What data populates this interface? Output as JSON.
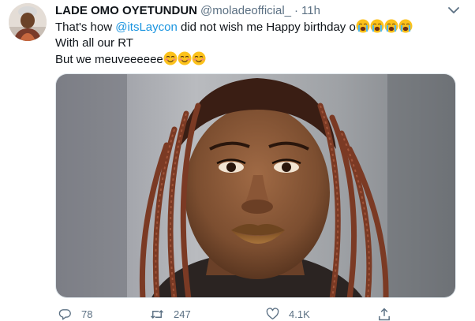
{
  "tweet": {
    "display_name": "LADE OMO OYETUNDUN",
    "handle": "@moladeofficial_",
    "separator": "·",
    "time": "11h",
    "text": {
      "line1_prefix": "That's how ",
      "line1_mention": "@itsLaycon",
      "line1_suffix": " did not wish me Happy birthday o",
      "line2": "With all our RT",
      "line3": "But we meuveeeeee"
    },
    "emojis": {
      "line1": [
        "loudly-crying-face",
        "loudly-crying-face",
        "loudly-crying-face",
        "loudly-crying-face"
      ],
      "line3": [
        "smiling-face-with-smiling-eyes",
        "smiling-face-with-smiling-eyes",
        "smiling-face-with-smiling-eyes"
      ]
    },
    "actions": {
      "reply_count": "78",
      "retweet_count": "247",
      "like_count": "4.1K"
    },
    "colors": {
      "text": "#0f1419",
      "secondary": "#5b7083",
      "link": "#1b95e0"
    }
  }
}
